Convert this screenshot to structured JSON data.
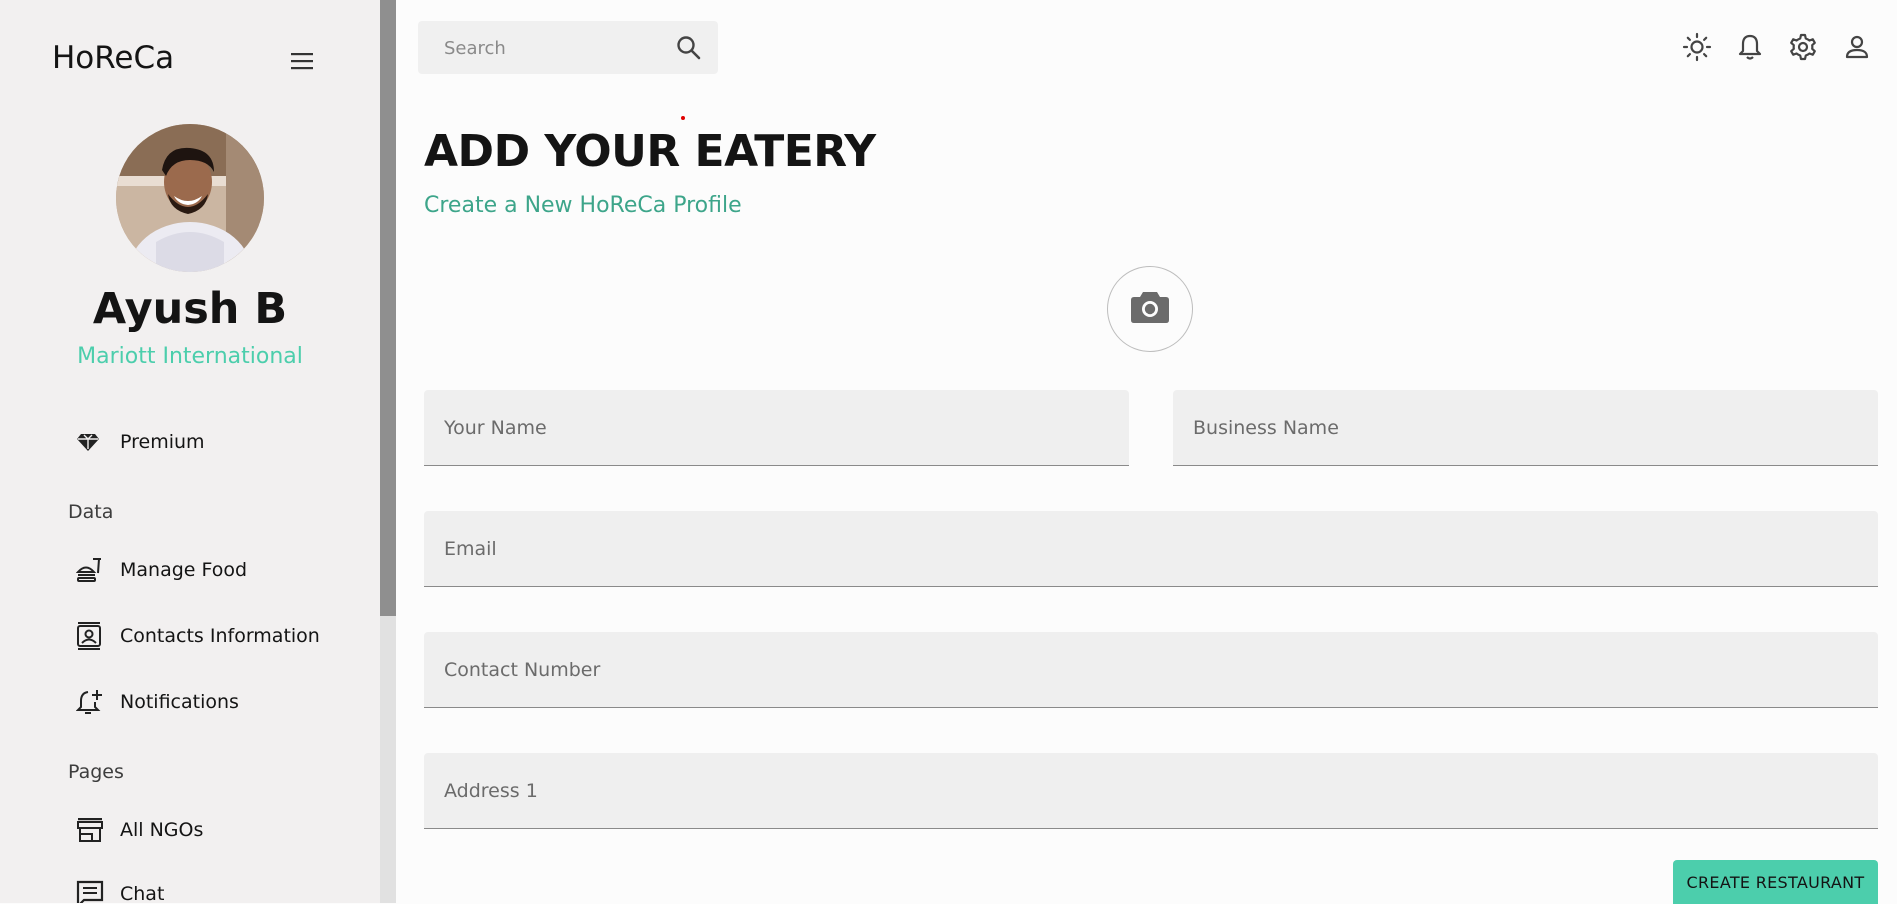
{
  "sidebar": {
    "brand": "HoReCa",
    "user": {
      "name": "Ayush B",
      "organization": "Mariott International"
    },
    "premium_item": {
      "label": "Premium",
      "icon": "diamond-icon"
    },
    "sections": [
      {
        "label": "Data",
        "items": [
          {
            "label": "Manage Food",
            "icon": "food-icon"
          },
          {
            "label": "Contacts Information",
            "icon": "contact-card-icon"
          },
          {
            "label": "Notifications",
            "icon": "notification-add-icon"
          }
        ]
      },
      {
        "label": "Pages",
        "items": [
          {
            "label": "All NGOs",
            "icon": "store-icon"
          },
          {
            "label": "Chat",
            "icon": "chat-icon"
          }
        ]
      }
    ]
  },
  "topbar": {
    "search_placeholder": "Search",
    "icons": [
      "sun-icon",
      "bell-icon",
      "gear-icon",
      "user-icon"
    ]
  },
  "main": {
    "title": "ADD YOUR EATERY",
    "subtitle": "Create a New HoReCa Profile",
    "fields": {
      "your_name": "Your Name",
      "business_name": "Business Name",
      "email": "Email",
      "contact_number": "Contact Number",
      "address1": "Address 1"
    },
    "submit_label": "CREATE RESTAURANT"
  },
  "colors": {
    "accent": "#4cceac",
    "subtitle": "#3da58a",
    "sidebar_bg": "#f2f0f0",
    "field_bg": "#efefef"
  }
}
